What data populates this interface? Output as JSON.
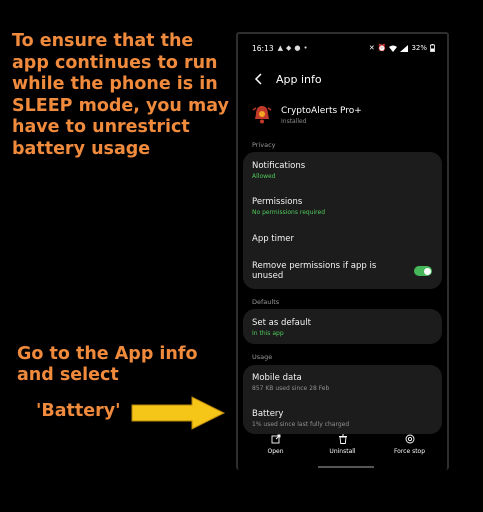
{
  "captions": {
    "top": "To ensure that the app continues to run while the phone is in SLEEP mode, you may have to unrestrict battery usage",
    "mid": "Go to the App info and select",
    "battery": "'Battery'"
  },
  "status_bar": {
    "time": "16:13",
    "battery_percent": "32%"
  },
  "header": {
    "title": "App info",
    "back_icon": "chevron-left-icon"
  },
  "app": {
    "name": "CryptoAlerts Pro+",
    "status": "Installed",
    "icon": "bell-icon",
    "icon_color": "#c0392b"
  },
  "sections": {
    "privacy": "Privacy",
    "defaults": "Defaults",
    "usage": "Usage"
  },
  "privacy_items": {
    "notifications": {
      "title": "Notifications",
      "sub": "Allowed"
    },
    "permissions": {
      "title": "Permissions",
      "sub": "No permissions required"
    },
    "app_timer": {
      "title": "App timer"
    },
    "remove_permissions": {
      "title": "Remove permissions if app is unused",
      "toggle_on": true
    }
  },
  "defaults_items": {
    "set_as_default": {
      "title": "Set as default",
      "sub": "In this app"
    }
  },
  "usage_items": {
    "mobile_data": {
      "title": "Mobile data",
      "sub": "857 KB used since 28 Feb"
    },
    "battery": {
      "title": "Battery",
      "sub": "1% used since last fully charged"
    }
  },
  "bottom_bar": {
    "open": "Open",
    "uninstall": "Uninstall",
    "force_stop": "Force stop"
  },
  "colors": {
    "caption": "#f08a3c",
    "arrow": "#f5c518",
    "accent_green": "#4fc95c",
    "card_bg": "#1c1c1c"
  }
}
